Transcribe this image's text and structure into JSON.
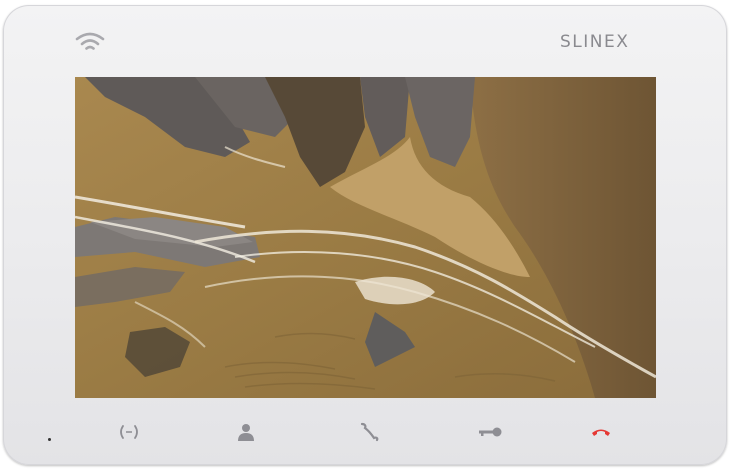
{
  "device": {
    "brand": "SLINEX"
  },
  "status": {
    "wifi_icon": "wifi-icon",
    "indicator": "power-indicator-dot"
  },
  "screen": {
    "content": "video-feed"
  },
  "controls": [
    {
      "name": "monitor-button",
      "icon": "monitor-waves-icon",
      "color": "#8e8e94"
    },
    {
      "name": "user-button",
      "icon": "user-icon",
      "color": "#8e8e94"
    },
    {
      "name": "answer-button",
      "icon": "phone-icon",
      "color": "#8e8e94"
    },
    {
      "name": "unlock-button",
      "icon": "key-icon",
      "color": "#8e8e94"
    },
    {
      "name": "hangup-button",
      "icon": "hangup-icon",
      "color": "#e53935"
    }
  ]
}
